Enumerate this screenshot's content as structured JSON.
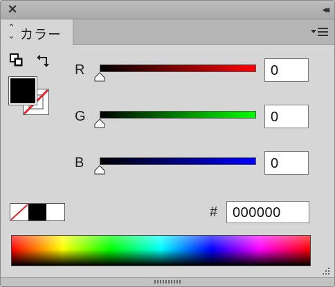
{
  "titlebar": {
    "close_glyph": "✕",
    "collapse_glyph": "◂◂",
    "icons": [
      "close-icon",
      "collapse-icon"
    ]
  },
  "tab": {
    "updown_icon": "updown-icon",
    "label": "カラー",
    "menu_icon": "panel-menu-icon"
  },
  "swatch_tools": {
    "default_colors_icon": "default-colors-icon",
    "swap_icon": "swap-arrow-icon"
  },
  "fill": {
    "color": "#000000"
  },
  "stroke": {
    "state": "none",
    "color": "#ffffff",
    "slash_color": "#e0242b"
  },
  "channels": [
    {
      "label": "R",
      "value": "0",
      "track_end": "#ff0000"
    },
    {
      "label": "G",
      "value": "0",
      "track_end": "#00ff00"
    },
    {
      "label": "B",
      "value": "0",
      "track_end": "#0000ff"
    }
  ],
  "mini_swatches": {
    "none_slash_color": "#e0242b",
    "black": "#000000",
    "white": "#ffffff"
  },
  "hex": {
    "hash": "#",
    "value": "000000"
  },
  "spectrum": {
    "name": "color-spectrum"
  },
  "bottom": {
    "grip_icon": "resize-grip-icon"
  }
}
